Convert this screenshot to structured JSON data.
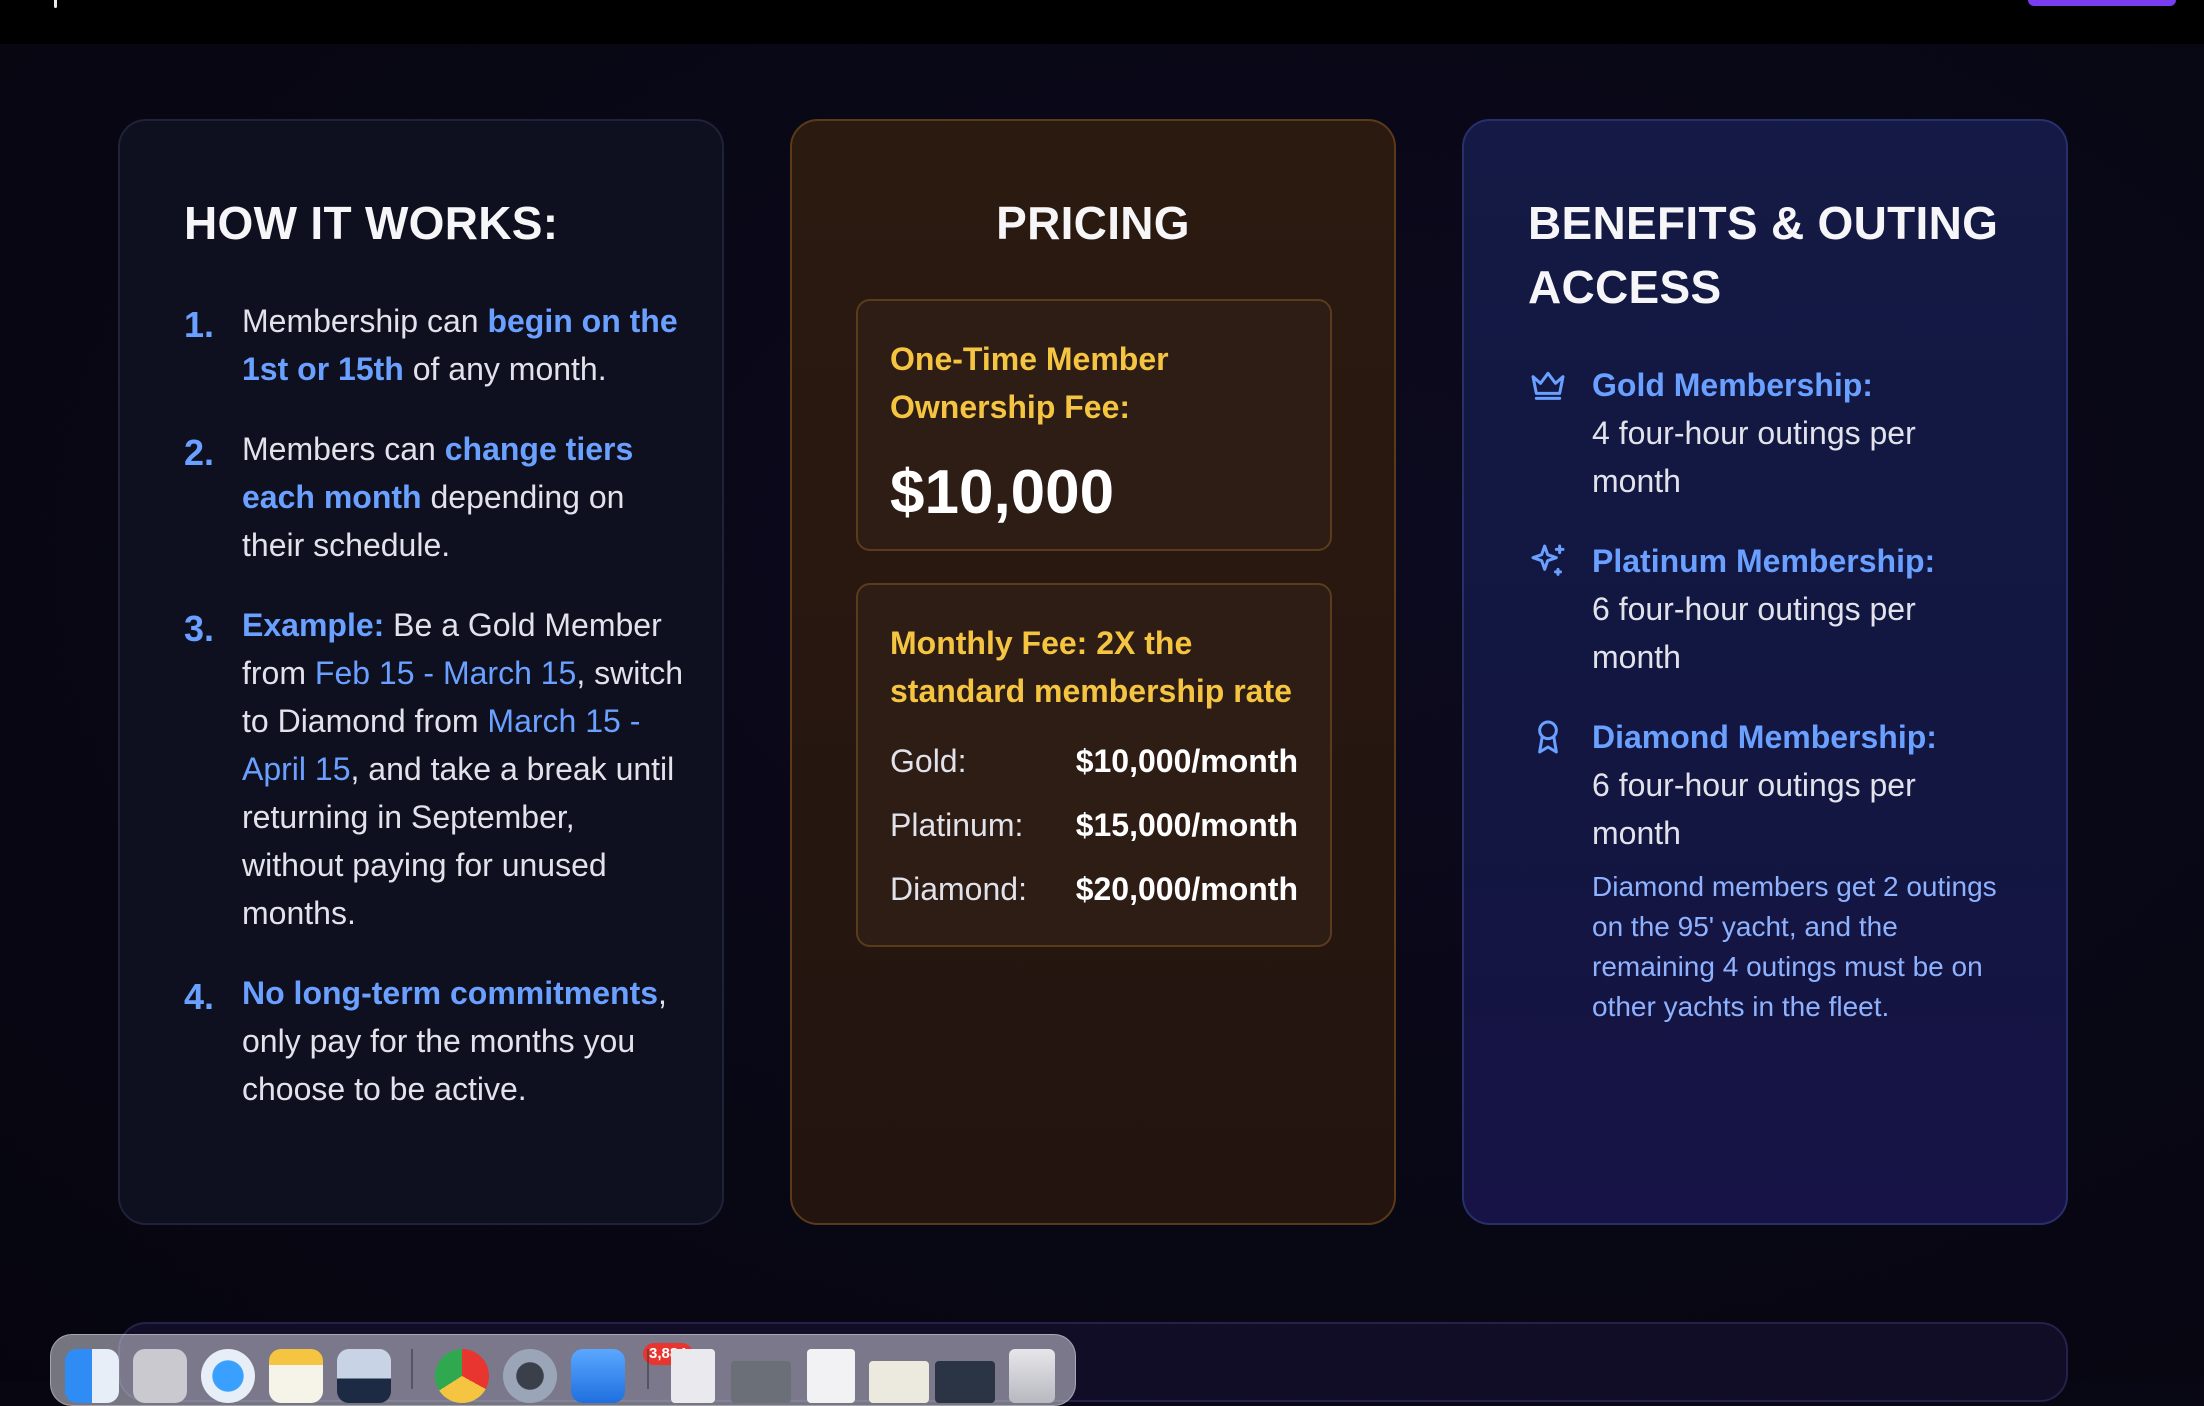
{
  "how_it_works": {
    "title": "HOW IT WORKS:",
    "steps": [
      {
        "num": "1.",
        "parts": [
          {
            "text": "Membership can ",
            "style": "plain"
          },
          {
            "text": "begin on the 1st or 15th",
            "style": "bold"
          },
          {
            "text": " of any month.",
            "style": "plain"
          }
        ]
      },
      {
        "num": "2.",
        "parts": [
          {
            "text": "Members can ",
            "style": "plain"
          },
          {
            "text": "change tiers each month",
            "style": "bold"
          },
          {
            "text": " depending on their schedule.",
            "style": "plain"
          }
        ]
      },
      {
        "num": "3.",
        "parts": [
          {
            "text": "Example:",
            "style": "bold"
          },
          {
            "text": " Be a Gold Member from ",
            "style": "plain"
          },
          {
            "text": "Feb 15 - March 15",
            "style": "link"
          },
          {
            "text": ", switch to Diamond from ",
            "style": "plain"
          },
          {
            "text": "March 15 - April 15",
            "style": "link"
          },
          {
            "text": ", and take a break until returning in September, without paying for unused months.",
            "style": "plain"
          }
        ]
      },
      {
        "num": "4.",
        "parts": [
          {
            "text": "No long-term commitments",
            "style": "bold"
          },
          {
            "text": ", only pay for the months you choose to be active.",
            "style": "plain"
          }
        ]
      }
    ]
  },
  "pricing": {
    "title": "PRICING",
    "one_time_label": "One-Time Member Ownership Fee:",
    "one_time_price": "$10,000",
    "monthly_label": "Monthly Fee: 2X the standard membership rate",
    "rates": [
      {
        "tier": "Gold:",
        "price": "$10,000/month"
      },
      {
        "tier": "Platinum:",
        "price": "$15,000/month"
      },
      {
        "tier": "Diamond:",
        "price": "$20,000/month"
      }
    ]
  },
  "benefits": {
    "title": "BENEFITS & OUTING ACCESS",
    "items": [
      {
        "icon": "crown-icon",
        "title": "Gold Membership:",
        "desc": "4 four-hour outings per month",
        "note": ""
      },
      {
        "icon": "sparkle-icon",
        "title": "Platinum Membership:",
        "desc": "6 four-hour outings per month",
        "note": ""
      },
      {
        "icon": "award-icon",
        "title": "Diamond Membership:",
        "desc": "6 four-hour outings per month",
        "note": "Diamond members get 2 outings on the 95' yacht, and the remaining 4 outings must be on other yachts in the fleet."
      }
    ]
  },
  "dock": {
    "mail_badge": "3,884",
    "apps": [
      "finder-icon",
      "launchpad-icon",
      "safari-icon",
      "notes-icon",
      "preview-icon",
      "chrome-icon",
      "proxyman-icon",
      "mail-icon",
      "document-icon",
      "screenshot-icon",
      "document-icon",
      "window-icon",
      "window-icon",
      "trash-icon"
    ]
  },
  "colors": {
    "accent_blue": "#6aa0ff",
    "gold": "#f5c542",
    "cta_purple": "#7a3cf0"
  }
}
